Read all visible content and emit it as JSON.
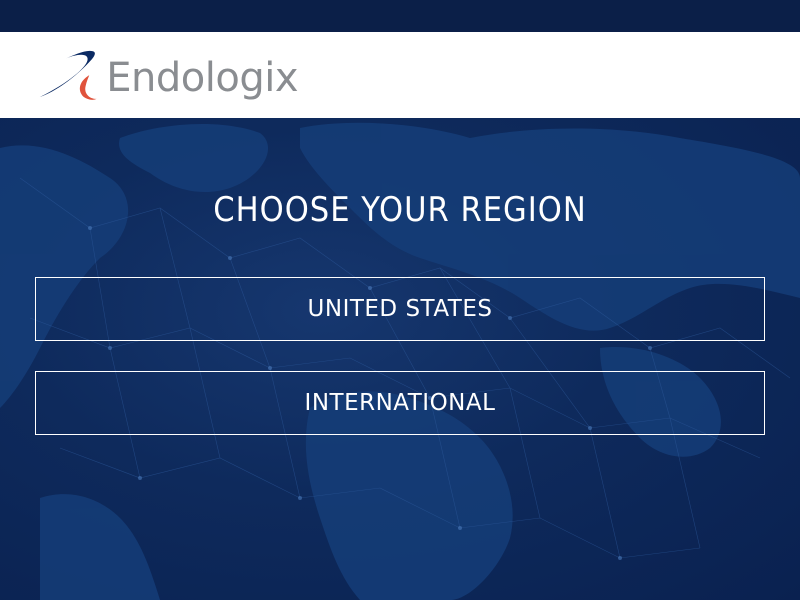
{
  "header": {
    "brand_name": "Endologix",
    "colors": {
      "brand_blue": "#0b2a63",
      "brand_red": "#e0533c",
      "brand_gray": "#8a8d91"
    }
  },
  "hero": {
    "title": "CHOOSE YOUR REGION",
    "buttons": [
      {
        "label": "UNITED STATES"
      },
      {
        "label": "INTERNATIONAL"
      }
    ],
    "background_color": "#0a2150"
  }
}
